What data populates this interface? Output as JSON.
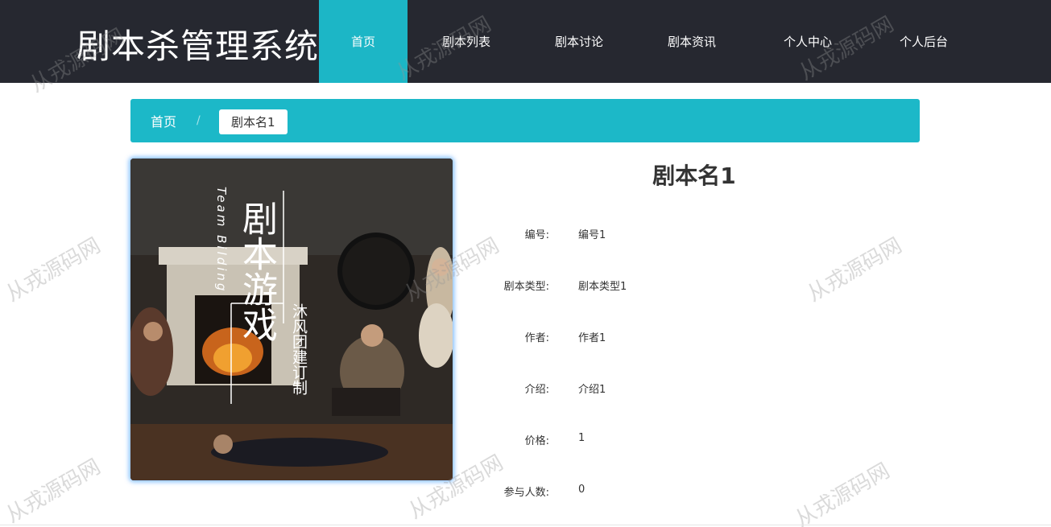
{
  "header": {
    "brand": "剧本杀管理系统",
    "nav": [
      {
        "label": "首页",
        "active": true
      },
      {
        "label": "剧本列表",
        "active": false
      },
      {
        "label": "剧本讨论",
        "active": false
      },
      {
        "label": "剧本资讯",
        "active": false
      },
      {
        "label": "个人中心",
        "active": false
      },
      {
        "label": "个人后台",
        "active": false
      }
    ]
  },
  "breadcrumb": {
    "home": "首页",
    "separator": "/",
    "current": "剧本名1"
  },
  "cover": {
    "title_vertical": "剧本游戏",
    "subtitle_vertical": "沐风团建订制",
    "english_vertical": "Team Bilding"
  },
  "detail": {
    "title": "剧本名1",
    "fields": [
      {
        "label": "编号:",
        "value": "编号1"
      },
      {
        "label": "剧本类型:",
        "value": "剧本类型1"
      },
      {
        "label": "作者:",
        "value": "作者1"
      },
      {
        "label": "介绍:",
        "value": "介绍1"
      },
      {
        "label": "价格:",
        "value": "1"
      },
      {
        "label": "参与人数:",
        "value": "0"
      }
    ]
  },
  "watermark": "从戎源码网",
  "colors": {
    "header_bg": "#262830",
    "accent": "#1cb8c8"
  }
}
